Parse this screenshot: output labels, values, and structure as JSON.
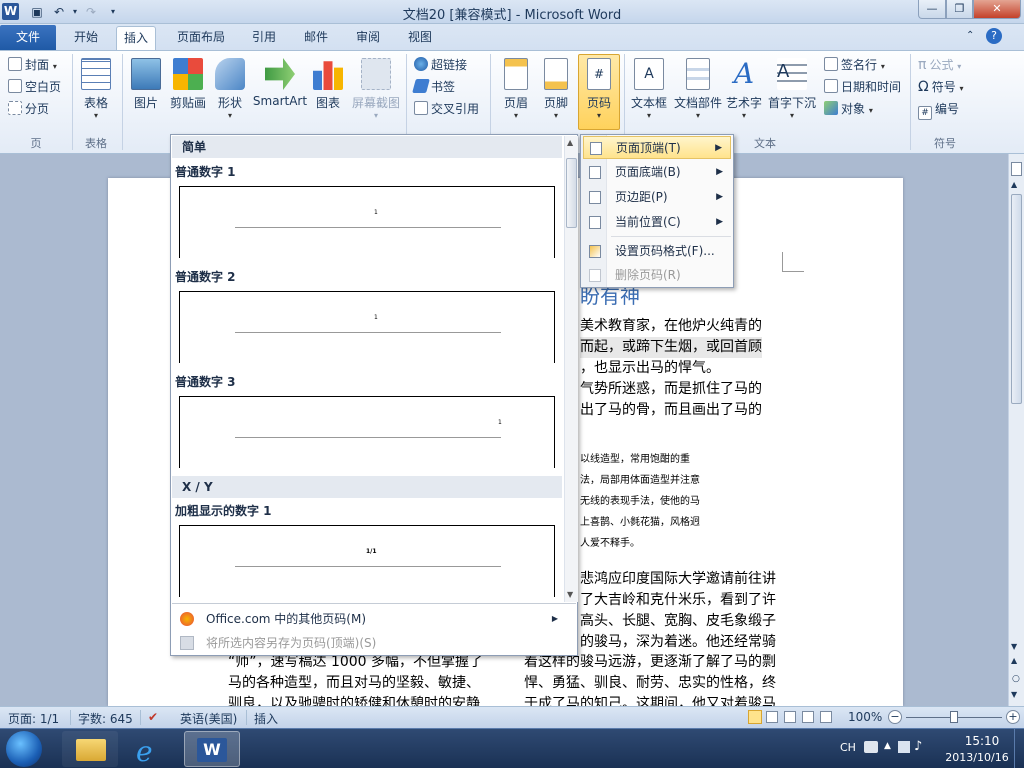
{
  "title_bar": {
    "app_icon": "W",
    "title": "文档20 [兼容模式] - Microsoft Word"
  },
  "ribbon_tabs": [
    "开始",
    "插入",
    "页面布局",
    "引用",
    "邮件",
    "审阅",
    "视图"
  ],
  "file_tab": "文件",
  "active_tab": "插入",
  "ribbon": {
    "page_group": {
      "items": [
        "封面",
        "空白页",
        "分页"
      ],
      "label": "页"
    },
    "table_group": {
      "button": "表格",
      "label": "表格"
    },
    "illustrations": [
      "图片",
      "剪贴画",
      "形状",
      "SmartArt",
      "图表",
      "屏幕截图"
    ],
    "links": [
      "超链接",
      "书签",
      "交叉引用"
    ],
    "header_footer": [
      "页眉",
      "页脚",
      "页码"
    ],
    "text_group": {
      "items": [
        "文本框",
        "文档部件",
        "艺术字",
        "首字下沉"
      ],
      "small": [
        "签名行",
        "日期和时间",
        "对象"
      ],
      "label": "文本"
    },
    "symbols": {
      "items": [
        "公式",
        "符号",
        "编号"
      ],
      "label": "符号"
    }
  },
  "gallery": {
    "section_simple": "简单",
    "items": [
      {
        "label": "普通数字 1",
        "num": "1"
      },
      {
        "label": "普通数字 2",
        "num": "1"
      },
      {
        "label": "普通数字 3",
        "num": "1"
      }
    ],
    "section_xy": "X / Y",
    "bold_item": {
      "label": "加粗显示的数字 1",
      "num": "1/1"
    },
    "footer_more": "Office.com 中的其他页码(M)",
    "footer_save": "将所选内容另存为页码(顶端)(S)"
  },
  "submenu": {
    "items": [
      {
        "label": "页面顶端(T)",
        "arrow": true,
        "highlighted": true
      },
      {
        "label": "页面底端(B)",
        "arrow": true
      },
      {
        "label": "页边距(P)",
        "arrow": true
      },
      {
        "label": "当前位置(C)",
        "arrow": true
      },
      {
        "label": "设置页码格式(F)..."
      },
      {
        "label": "删除页码(R)",
        "disabled": true
      }
    ]
  },
  "document": {
    "heading_fragment": "盼有神",
    "lines_right": [
      "美术教育家，在他炉火纯青的",
      "而起，或蹄下生烟，或回首顾",
      "，也显示出马的悍气。",
      "气势所迷惑，而是抓住了马的",
      "出了马的骨，而且画出了马的"
    ],
    "small_lines": [
      "以线造型，常用饱酣的重",
      "法，局部用体面造型并注意",
      "无线的表现手法，使他的马",
      "上喜鹊、小毵花猫，风格迥",
      "人爱不释手。"
    ],
    "para2_lines": [
      "悲鸿应印度国际大学邀请前往讲",
      "了大吉岭和克什米乐，看到了许",
      "高头、长腿、宽胸、皮毛象缎子",
      "的骏马，深为着迷。他还经常骑"
    ],
    "bottom_left": [
      "“师”，速写稿达 1000 多幅，不但掌握了",
      "马的各种造型，而且对马的坚毅、敏捷、",
      "驯良，以及驰骋时的矫健和休憩时的安静"
    ],
    "bottom_right": [
      "着这样的骏马远游，更逐渐了解了马的剽",
      "悍、勇猛、驯良、耐劳、忠实的性格，终",
      "于成了马的知己。这期间，他又对着骏马"
    ]
  },
  "status_bar": {
    "page": "页面: 1/1",
    "words": "字数: 645",
    "language": "英语(美国)",
    "mode": "插入",
    "zoom": "100%"
  },
  "taskbar": {
    "ime": "CH",
    "time": "15:10",
    "date": "2013/10/16"
  },
  "colors": {
    "accent": "#2b579a",
    "file_tab": "#1f5aa6",
    "highlight": "#ffe38c"
  }
}
